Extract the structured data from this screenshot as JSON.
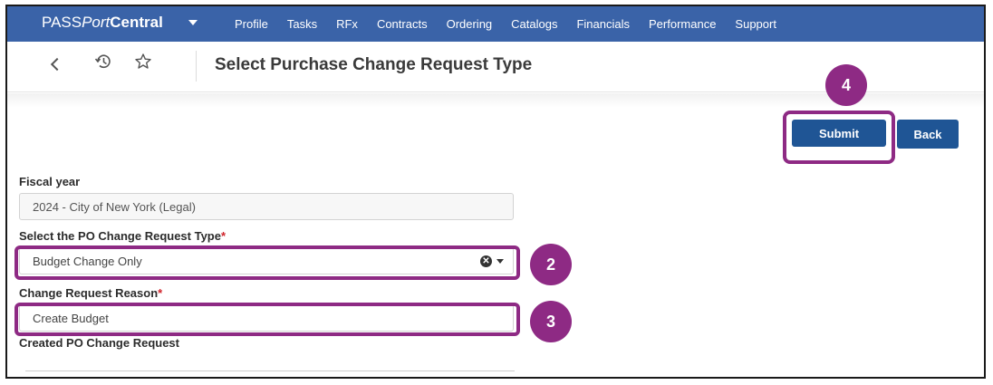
{
  "brand": {
    "part1": "PASS",
    "part2": "Port",
    "part3": "Central"
  },
  "nav": {
    "items": [
      {
        "label": "Profile"
      },
      {
        "label": "Tasks"
      },
      {
        "label": "RFx"
      },
      {
        "label": "Contracts"
      },
      {
        "label": "Ordering"
      },
      {
        "label": "Catalogs"
      },
      {
        "label": "Financials"
      },
      {
        "label": "Performance"
      },
      {
        "label": "Support"
      }
    ]
  },
  "header": {
    "title": "Select Purchase Change Request Type"
  },
  "actions": {
    "submit_label": "Submit",
    "back_label": "Back"
  },
  "form": {
    "fiscal_year": {
      "label": "Fiscal year",
      "value": "2024 - City of New York (Legal)"
    },
    "change_type": {
      "label": "Select the PO Change Request Type",
      "required_mark": "*",
      "value": "Budget Change Only",
      "clear_glyph": "✕"
    },
    "reason": {
      "label": "Change Request Reason",
      "required_mark": "*",
      "value": "Create Budget"
    },
    "created": {
      "label": "Created PO Change Request"
    }
  },
  "callouts": {
    "submit": "4",
    "change_type": "2",
    "reason": "3"
  },
  "colors": {
    "nav_bg": "#3a63a8",
    "button": "#1f5595",
    "callout": "#8e2a84",
    "required": "#d0242b"
  },
  "icons": [
    "back-chevron-icon",
    "history-icon",
    "star-icon",
    "brand-caret-icon",
    "clear-icon",
    "dropdown-caret-icon"
  ]
}
